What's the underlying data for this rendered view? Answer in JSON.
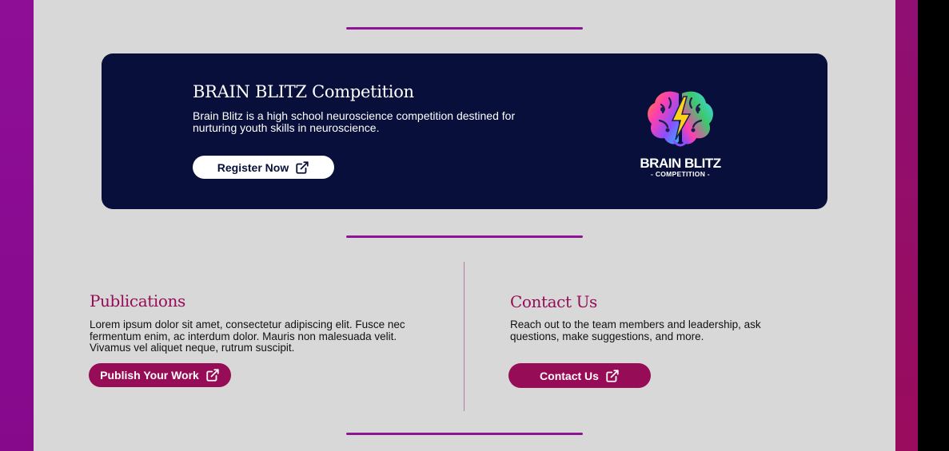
{
  "banner": {
    "title": "BRAIN BLITZ Competition",
    "description": "Brain Blitz is a high school neuroscience competition destined for nurturing youth skills in neuroscience.",
    "button_label": "Register Now",
    "logo": {
      "text_main": "BRAIN BLITZ",
      "text_sub": "- COMPETITION -"
    }
  },
  "publications": {
    "title": "Publications",
    "text": "Lorem ipsum dolor sit amet, consectetur adipiscing elit. Fusce nec fermentum enim, ac interdum dolor. Mauris non malesuada velit. Vivamus vel aliquet neque, rutrum suscipit.",
    "button_label": "Publish Your Work"
  },
  "contact": {
    "title": "Contact Us",
    "text": "Reach out to the team members and leadership, ask questions, make suggestions, and more.",
    "button_label": "Contact Us"
  },
  "colors": {
    "accent_purple": "#8c1596",
    "accent_magenta": "#950d57",
    "banner_navy": "#070f3a",
    "page_bg": "#d9d8d9"
  },
  "icons": {
    "button_icon": "external-link-icon"
  }
}
